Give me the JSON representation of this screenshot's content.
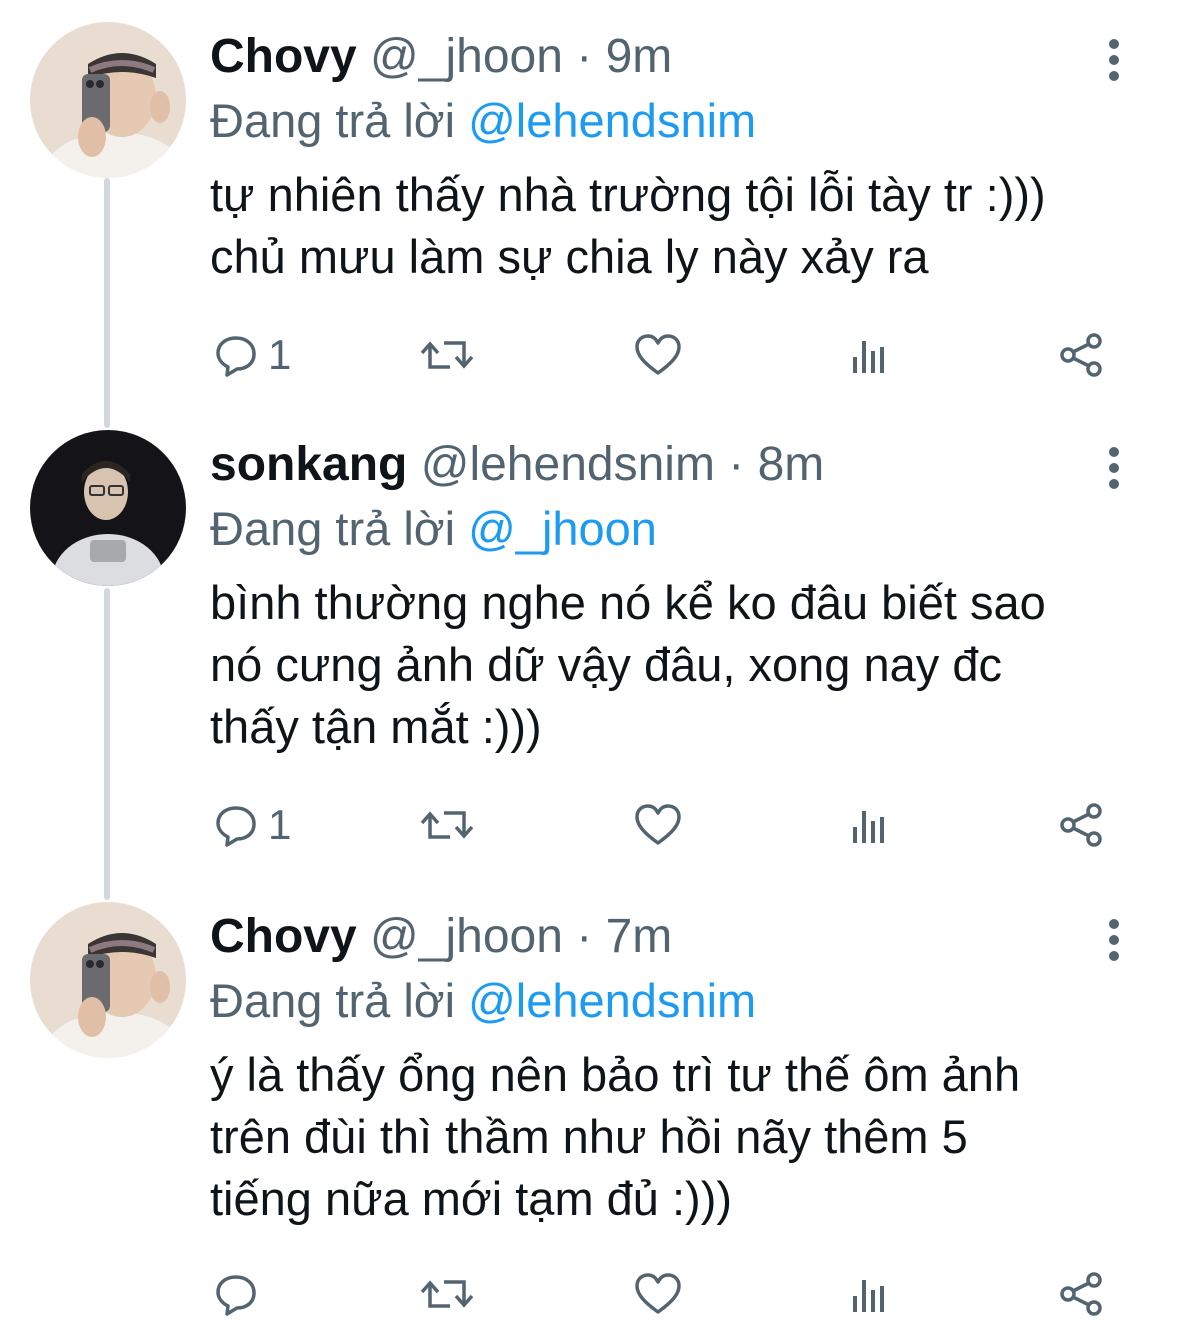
{
  "tweets": [
    {
      "name": "Chovy",
      "handle": "@_jhoon",
      "separator": "·",
      "time": "9m",
      "replying_prefix": "Đang trả lời",
      "replying_to": "@lehendsnim",
      "lines": [
        "tự nhiên thấy nhà trường tội lỗi tày tr :)))",
        "chủ mưu làm sự chia ly này xảy ra"
      ],
      "reply_count": "1",
      "avatar_icon": "avatar-photo-mirror-selfie"
    },
    {
      "name": "sonkang",
      "handle": "@lehendsnim",
      "separator": "·",
      "time": "8m",
      "replying_prefix": "Đang trả lời",
      "replying_to": "@_jhoon",
      "lines": [
        "bình thường nghe nó kể ko đâu biết sao",
        "nó cưng ảnh dữ vậy đâu, xong nay đc",
        "thấy tận mắt :)))"
      ],
      "reply_count": "1",
      "avatar_icon": "avatar-photo-dark-portrait"
    },
    {
      "name": "Chovy",
      "handle": "@_jhoon",
      "separator": "·",
      "time": "7m",
      "replying_prefix": "Đang trả lời",
      "replying_to": "@lehendsnim",
      "lines": [
        "ý là thấy ổng nên bảo trì tư thế ôm ảnh",
        "trên đùi thì thầm như hồi nãy thêm 5",
        "tiếng nữa mới tạm đủ :)))"
      ],
      "reply_count": "",
      "avatar_icon": "avatar-photo-mirror-selfie"
    }
  ],
  "icons": {
    "more": "more-vertical-icon",
    "reply": "reply-bubble-icon",
    "retweet": "retweet-icon",
    "like": "heart-icon",
    "views": "analytics-icon",
    "share": "share-icon"
  },
  "colors": {
    "name": "#0f1419",
    "secondary": "#536471",
    "mention": "#1d9bf0",
    "thread_line": "#cfd9de"
  }
}
